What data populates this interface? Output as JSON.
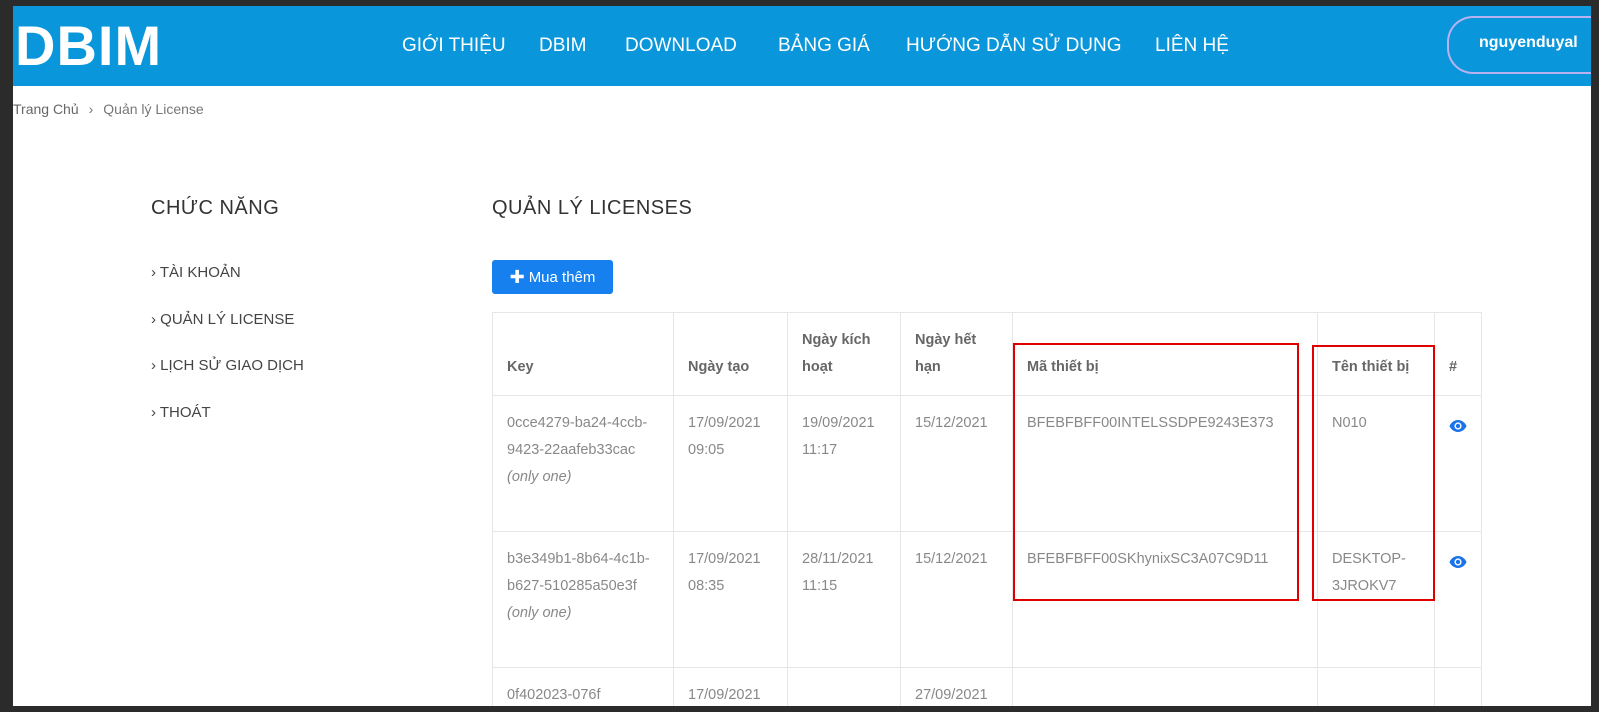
{
  "header": {
    "logo": "DBIM",
    "nav": [
      "GIỚI THIỆU",
      "DBIM",
      "DOWNLOAD",
      "BẢNG GIÁ",
      "HƯỚNG DẪN SỬ DỤNG",
      "LIÊN HỆ"
    ],
    "user": "nguyenduyal"
  },
  "breadcrumb": {
    "home": "Trang Chủ",
    "separator": "›",
    "current": "Quản lý License"
  },
  "sidebar": {
    "title": "CHỨC NĂNG",
    "items": [
      "› TÀI KHOẢN",
      "› QUẢN LÝ LICENSE",
      "› LỊCH SỬ GIAO DỊCH",
      "› THOÁT"
    ]
  },
  "main": {
    "title": "QUẢN LÝ LICENSES",
    "buy_label": "Mua thêm",
    "table": {
      "headers": [
        "Key",
        "Ngày tạo",
        "Ngày kích hoạt",
        "Ngày hết hạn",
        "Mã thiết bị",
        "Tên thiết bị",
        "#"
      ],
      "rows": [
        {
          "key": "0cce4279-ba24-4ccb-9423-22aafeb33cac",
          "note": "(only one)",
          "created": "17/09/2021 09:05",
          "activated": "19/09/2021 11:17",
          "expires": "15/12/2021",
          "device_id": "BFEBFBFF00INTELSSDPE9243E373",
          "device_name": "N010"
        },
        {
          "key": "b3e349b1-8b64-4c1b-b627-510285a50e3f",
          "note": "(only one)",
          "created": "17/09/2021 08:35",
          "activated": "28/11/2021 11:15",
          "expires": "15/12/2021",
          "device_id": "BFEBFBFF00SKhynixSC3A07C9D11",
          "device_name": "DESKTOP-3JROKV7"
        },
        {
          "key": "0f402023-076f",
          "note": "",
          "created": "17/09/2021",
          "activated": "",
          "expires": "27/09/2021",
          "device_id": "",
          "device_name": ""
        }
      ]
    }
  },
  "colors": {
    "header_bg": "#0a96da",
    "button_bg": "#1580ee",
    "highlight": "#e00000",
    "eye_icon": "#1a73e8"
  },
  "icons": {
    "view": "eye-icon",
    "add": "plus-icon"
  }
}
